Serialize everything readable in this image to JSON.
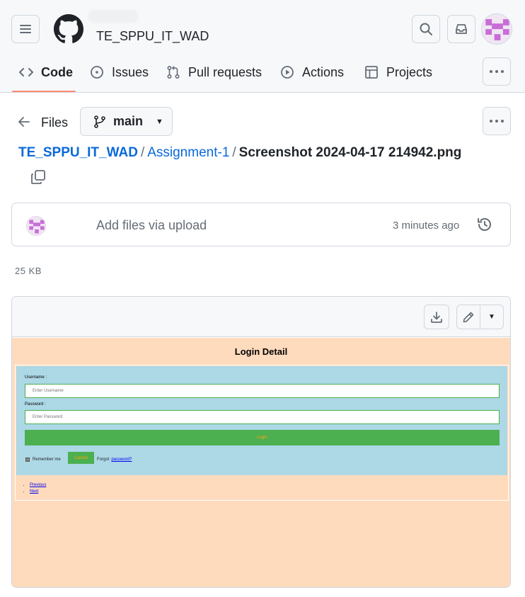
{
  "header": {
    "repo_name": "TE_SPPU_IT_WAD",
    "tabs": [
      {
        "label": "Code"
      },
      {
        "label": "Issues"
      },
      {
        "label": "Pull requests"
      },
      {
        "label": "Actions"
      },
      {
        "label": "Projects"
      }
    ]
  },
  "file_nav": {
    "files_label": "Files",
    "branch": "main"
  },
  "breadcrumb": {
    "repo": "TE_SPPU_IT_WAD",
    "folder": "Assignment-1",
    "file": "Screenshot 2024-04-17 214942.png",
    "separator": "/"
  },
  "commit": {
    "message": "Add files via upload",
    "time": "3 minutes ago"
  },
  "file_size": "25 KB",
  "embedded": {
    "title": "Login Detail",
    "username_label": "Username :",
    "username_placeholder": "Enter Username",
    "password_label": "Password :",
    "password_placeholder": "Enter Password",
    "login_label": "Login",
    "remember_label": "Remember me",
    "cancel_label": "Cancel",
    "forgot_text": "Forgot",
    "forgot_link": "password?",
    "links": [
      "Previous",
      "Next"
    ]
  },
  "colors": {
    "accent_link": "#0969da",
    "tab_underline": "#fd8c73",
    "embed_background": "#ffdbbd",
    "embed_form": "#add8e6",
    "embed_button": "#4caf50",
    "embed_button_text": "#ffa500"
  }
}
